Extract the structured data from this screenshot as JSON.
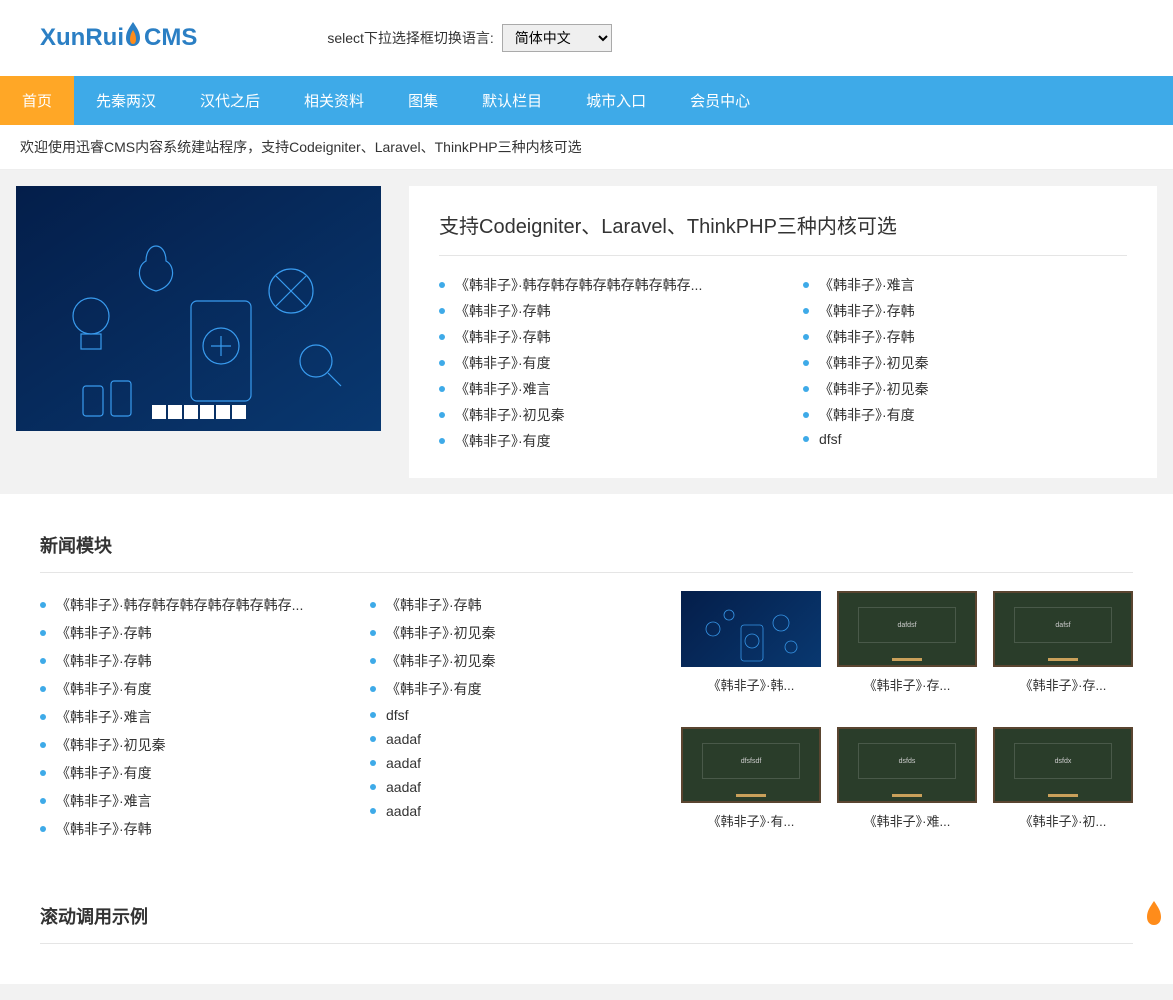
{
  "header": {
    "logo_xun": "XunRui",
    "logo_cms": "CMS",
    "lang_label": "select下拉选择框切换语言:",
    "lang_selected": "简体中文"
  },
  "nav": {
    "items": [
      {
        "label": "首页",
        "active": true
      },
      {
        "label": "先秦两汉",
        "active": false
      },
      {
        "label": "汉代之后",
        "active": false
      },
      {
        "label": "相关资料",
        "active": false
      },
      {
        "label": "图集",
        "active": false
      },
      {
        "label": "默认栏目",
        "active": false
      },
      {
        "label": "城市入口",
        "active": false
      },
      {
        "label": "会员中心",
        "active": false
      }
    ]
  },
  "announcement": "欢迎使用迅睿CMS内容系统建站程序，支持Codeigniter、Laravel、ThinkPHP三种内核可选",
  "feature_panel": {
    "title": "支持Codeigniter、Laravel、ThinkPHP三种内核可选",
    "left_list": [
      "《韩非子》·韩存韩存韩存韩存韩存韩存...",
      "《韩非子》·存韩",
      "《韩非子》·存韩",
      "《韩非子》·有度",
      "《韩非子》·难言",
      "《韩非子》·初见秦",
      "《韩非子》·有度"
    ],
    "right_list": [
      "《韩非子》·难言",
      "《韩非子》·存韩",
      "《韩非子》·存韩",
      "《韩非子》·初见秦",
      "《韩非子》·初见秦",
      "《韩非子》·有度",
      "dfsf"
    ]
  },
  "news_section": {
    "title": "新闻模块",
    "col1": [
      "《韩非子》·韩存韩存韩存韩存韩存韩存...",
      "《韩非子》·存韩",
      "《韩非子》·存韩",
      "《韩非子》·有度",
      "《韩非子》·难言",
      "《韩非子》·初见秦",
      "《韩非子》·有度",
      "《韩非子》·难言",
      "《韩非子》·存韩"
    ],
    "col2": [
      "《韩非子》·存韩",
      "《韩非子》·初见秦",
      "《韩非子》·初见秦",
      "《韩非子》·有度",
      "dfsf",
      "aadaf",
      "aadaf",
      "aadaf",
      "aadaf"
    ],
    "thumbs": [
      {
        "caption": "《韩非子》·韩...",
        "style": "blue"
      },
      {
        "caption": "《韩非子》·存...",
        "style": "board",
        "inner": "dafdsf"
      },
      {
        "caption": "《韩非子》·存...",
        "style": "board",
        "inner": "dafsf"
      },
      {
        "caption": "《韩非子》·有...",
        "style": "board",
        "inner": "dfsfsdf"
      },
      {
        "caption": "《韩非子》·难...",
        "style": "board",
        "inner": "dsfds"
      },
      {
        "caption": "《韩非子》·初...",
        "style": "board",
        "inner": "dsfdx"
      }
    ]
  },
  "scroll_section": {
    "title": "滚动调用示例"
  }
}
